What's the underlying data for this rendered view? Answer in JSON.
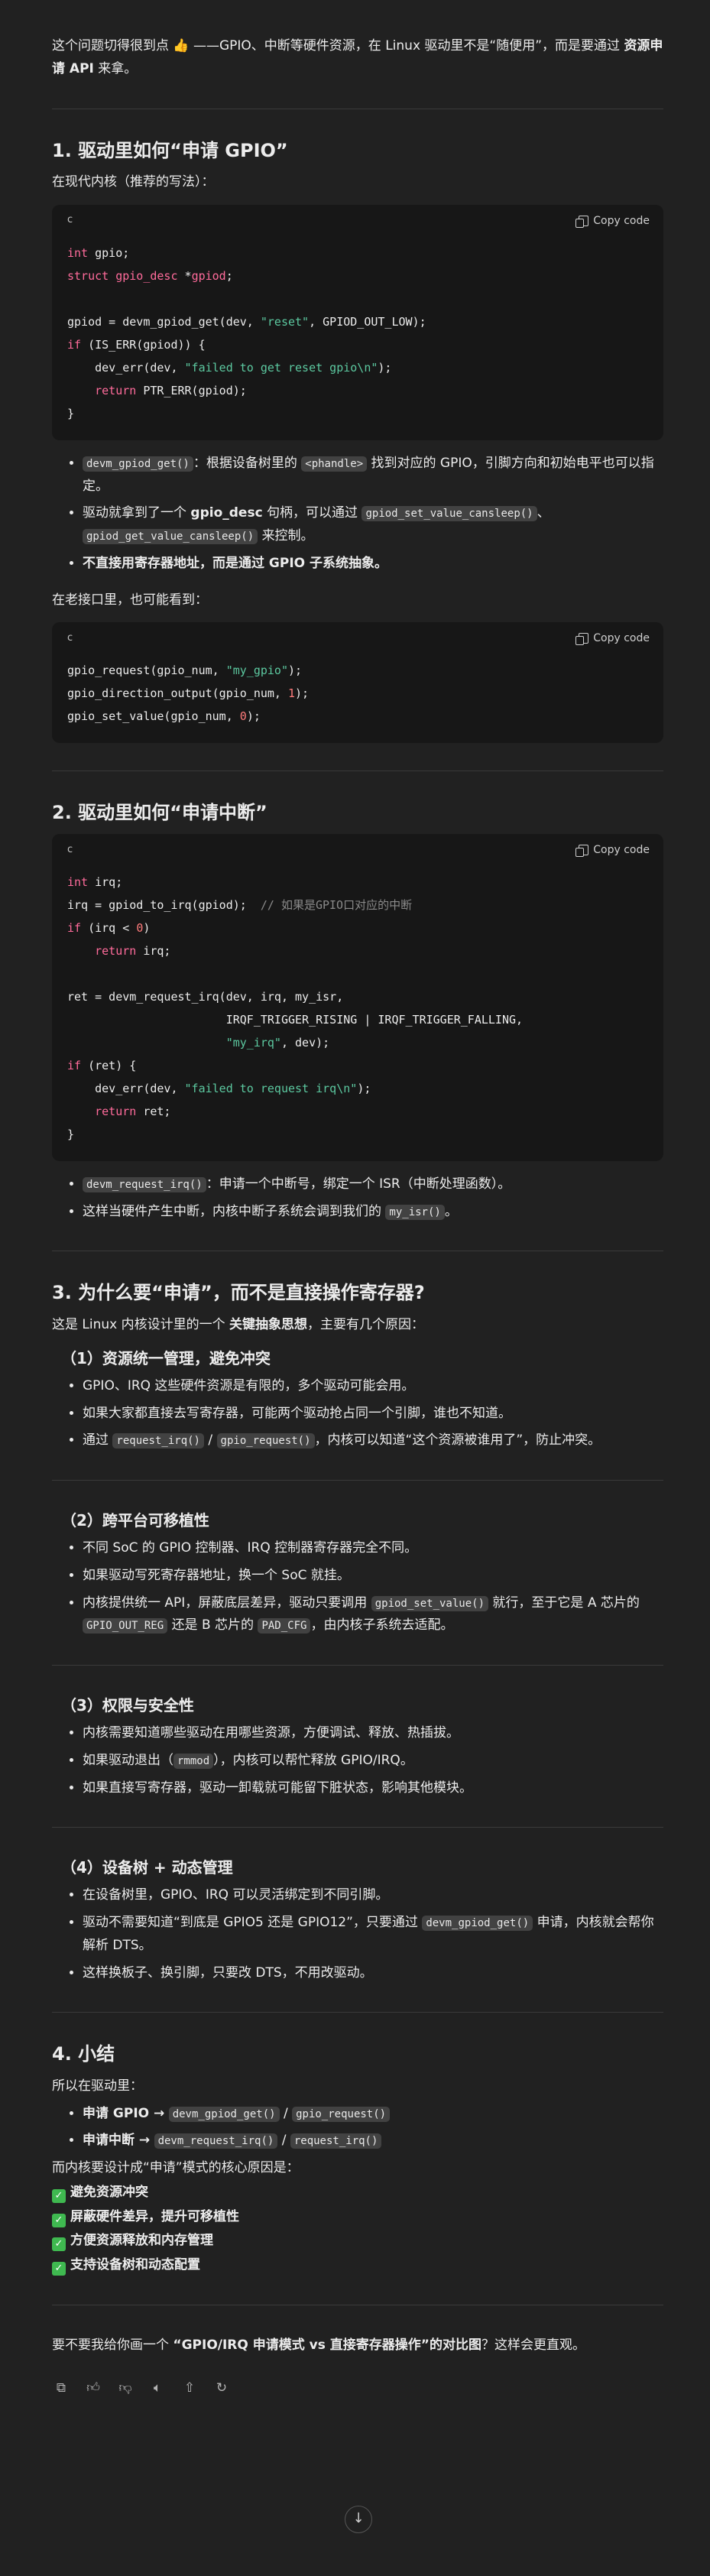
{
  "intro": {
    "p1": "这个问题切得很到点",
    "emoji": "👍",
    "p2": "——GPIO、中断等硬件资源，在 Linux 驱动里不是“随便用”，而是要通过",
    "p2_bold": "资源申请 API",
    "p2_end": "来拿。"
  },
  "copy_label": "Copy code",
  "lang_c": "c",
  "s1": {
    "title": "1. 驱动里如何“申请 GPIO”",
    "sub": "在现代内核（推荐的写法）：",
    "b1_code": "devm_gpiod_get()",
    "b1_a": "：根据设备树里的",
    "b1_code2": "<phandle>",
    "b1_b": "找到对应的 GPIO，引脚方向和初始电平也可以指定。",
    "b2_a": "驱动就拿到了一个",
    "b2_bold": "gpio_desc",
    "b2_b": "句柄，可以通过",
    "b2_code": "gpiod_set_value_cansleep()",
    "b2_c": "、",
    "b2_code2": "gpiod_get_value_cansleep()",
    "b2_d": "来控制。",
    "b3": "不直接用寄存器地址，而是通过 GPIO 子系统抽象。",
    "old": "在老接口里，也可能看到："
  },
  "s2": {
    "title": "2. 驱动里如何“申请中断”",
    "b1_code": "devm_request_irq()",
    "b1": "：申请一个中断号，绑定一个 ISR（中断处理函数）。",
    "b2_a": "这样当硬件产生中断，内核中断子系统会调到我们的",
    "b2_code": "my_isr()",
    "b2_b": "。"
  },
  "s3": {
    "title": "3. 为什么要“申请”，而不是直接操作寄存器?",
    "intro_a": "这是 Linux 内核设计里的一个",
    "intro_bold": "关键抽象思想",
    "intro_b": "，主要有几个原因：",
    "h1": "（1）资源统一管理，避免冲突",
    "h1_b1": "GPIO、IRQ 这些硬件资源是有限的，多个驱动可能会用。",
    "h1_b2": "如果大家都直接去写寄存器，可能两个驱动抢占同一个引脚，谁也不知道。",
    "h1_b3_a": "通过",
    "h1_b3_code": "request_irq()",
    "h1_b3_sep": "/",
    "h1_b3_code2": "gpio_request()",
    "h1_b3_b": "，内核可以知道“这个资源被谁用了”，防止冲突。",
    "h2": "（2）跨平台可移植性",
    "h2_b1": "不同 SoC 的 GPIO 控制器、IRQ 控制器寄存器完全不同。",
    "h2_b2": "如果驱动写死寄存器地址，换一个 SoC 就挂。",
    "h2_b3_a": "内核提供统一 API，屏蔽底层差异，驱动只要调用",
    "h2_b3_code": "gpiod_set_value()",
    "h2_b3_b": "就行，至于它是 A 芯片的",
    "h2_b3_code2": "GPIO_OUT_REG",
    "h2_b3_c": "还是 B 芯片的",
    "h2_b3_code3": "PAD_CFG",
    "h2_b3_d": "，由内核子系统去适配。",
    "h3": "（3）权限与安全性",
    "h3_b1": "内核需要知道哪些驱动在用哪些资源，方便调试、释放、热插拔。",
    "h3_b2_a": "如果驱动退出（",
    "h3_b2_code": "rmmod",
    "h3_b2_b": "），内核可以帮忙释放 GPIO/IRQ。",
    "h3_b3": "如果直接写寄存器，驱动一卸载就可能留下脏状态，影响其他模块。",
    "h4": "（4）设备树 + 动态管理",
    "h4_b1": "在设备树里，GPIO、IRQ 可以灵活绑定到不同引脚。",
    "h4_b2_a": "驱动不需要知道“到底是 GPIO5 还是 GPIO12”，只要通过",
    "h4_b2_code": "devm_gpiod_get()",
    "h4_b2_b": "申请，内核就会帮你解析 DTS。",
    "h4_b3": "这样换板子、换引脚，只要改 DTS，不用改驱动。"
  },
  "s4": {
    "title": "4. 小结",
    "intro": "所以在驱动里：",
    "b1_bold": "申请 GPIO →",
    "b1_code": "devm_gpiod_get()",
    "b1_sep": "/",
    "b1_code2": "gpio_request()",
    "b2_bold": "申请中断 →",
    "b2_code": "devm_request_irq()",
    "b2_sep": "/",
    "b2_code2": "request_irq()",
    "core": "而内核要设计成“申请”模式的核心原因是：",
    "checks": [
      "避免资源冲突",
      "屏蔽硬件差异，提升可移植性",
      "方便资源释放和内存管理",
      "支持设备树和动态配置"
    ]
  },
  "outro": {
    "a": "要不要我给你画一个",
    "bold": "“GPIO/IRQ 申请模式 vs 直接寄存器操作”的对比图",
    "b": "？这样会更直观。"
  },
  "actions": [
    "copy-icon",
    "thumbs-up-icon",
    "thumbs-down-icon",
    "speaker-icon",
    "share-icon",
    "regenerate-icon"
  ],
  "scroll_icon": "arrow-down-icon"
}
